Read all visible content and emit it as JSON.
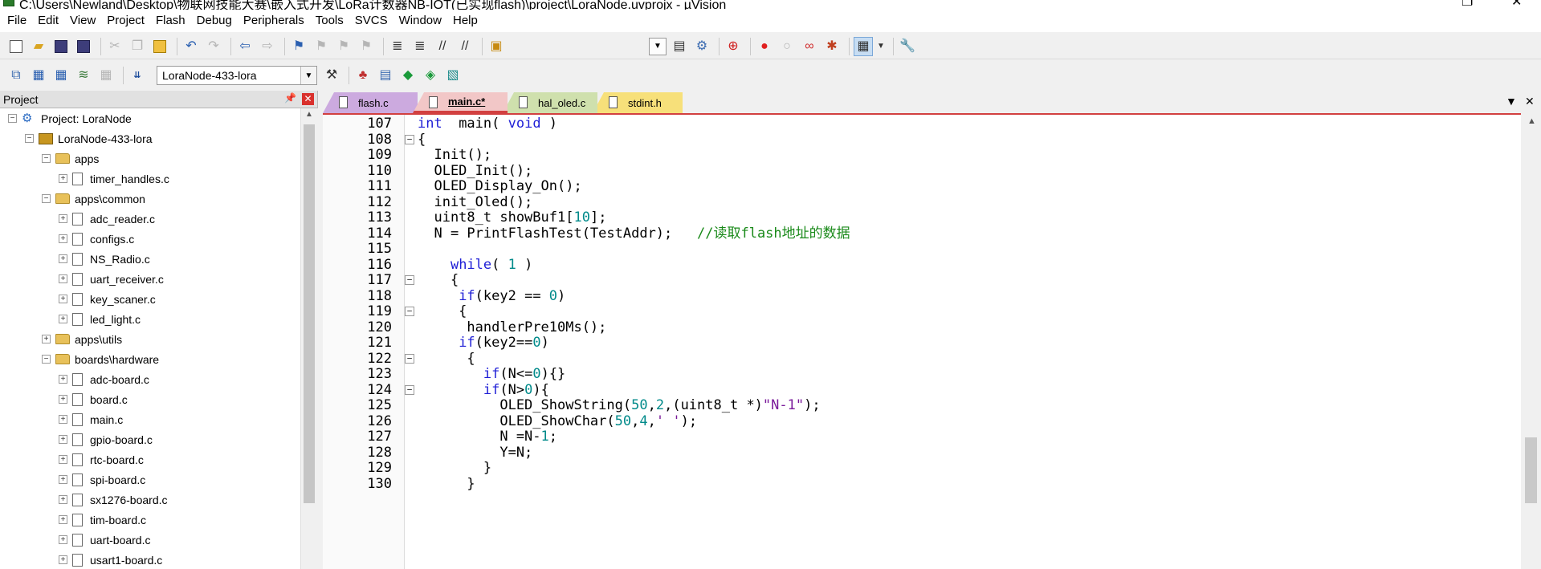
{
  "window": {
    "title": "C:\\Users\\Newland\\Desktop\\物联网技能大赛\\嵌入式开发\\LoRa计数器NB-IOT(已实现flash)\\project\\LoraNode.uvprojx - µVision"
  },
  "menu": [
    "File",
    "Edit",
    "View",
    "Project",
    "Flash",
    "Debug",
    "Peripherals",
    "Tools",
    "SVCS",
    "Window",
    "Help"
  ],
  "toolbar": {
    "target_name": "LoraNode-433-lora"
  },
  "project_panel": {
    "title": "Project",
    "tree": [
      {
        "label": "Project: LoraNode",
        "type": "project",
        "level": 0,
        "expander": "⊟"
      },
      {
        "label": "LoraNode-433-lora",
        "type": "target",
        "level": 1,
        "expander": "⊟"
      },
      {
        "label": "apps",
        "type": "folder",
        "level": 2,
        "expander": "⊟"
      },
      {
        "label": "timer_handles.c",
        "type": "file",
        "level": 3,
        "expander": "⊞"
      },
      {
        "label": "apps\\common",
        "type": "folder",
        "level": 2,
        "expander": "⊟"
      },
      {
        "label": "adc_reader.c",
        "type": "file",
        "level": 3,
        "expander": "⊞"
      },
      {
        "label": "configs.c",
        "type": "file",
        "level": 3,
        "expander": "⊞"
      },
      {
        "label": "NS_Radio.c",
        "type": "file",
        "level": 3,
        "expander": "⊞"
      },
      {
        "label": "uart_receiver.c",
        "type": "file",
        "level": 3,
        "expander": "⊞"
      },
      {
        "label": "key_scaner.c",
        "type": "file",
        "level": 3,
        "expander": "⊞"
      },
      {
        "label": "led_light.c",
        "type": "file",
        "level": 3,
        "expander": "⊞"
      },
      {
        "label": "apps\\utils",
        "type": "folder",
        "level": 2,
        "expander": "⊞"
      },
      {
        "label": "boards\\hardware",
        "type": "folder",
        "level": 2,
        "expander": "⊟"
      },
      {
        "label": "adc-board.c",
        "type": "file",
        "level": 3,
        "expander": "⊞"
      },
      {
        "label": "board.c",
        "type": "file",
        "level": 3,
        "expander": "⊞"
      },
      {
        "label": "main.c",
        "type": "file",
        "level": 3,
        "expander": "⊞"
      },
      {
        "label": "gpio-board.c",
        "type": "file",
        "level": 3,
        "expander": "⊞"
      },
      {
        "label": "rtc-board.c",
        "type": "file",
        "level": 3,
        "expander": "⊞"
      },
      {
        "label": "spi-board.c",
        "type": "file",
        "level": 3,
        "expander": "⊞"
      },
      {
        "label": "sx1276-board.c",
        "type": "file",
        "level": 3,
        "expander": "⊞"
      },
      {
        "label": "tim-board.c",
        "type": "file",
        "level": 3,
        "expander": "⊞"
      },
      {
        "label": "uart-board.c",
        "type": "file",
        "level": 3,
        "expander": "⊞"
      },
      {
        "label": "usart1-board.c",
        "type": "file",
        "level": 3,
        "expander": "⊞"
      }
    ]
  },
  "tabs": [
    {
      "label": "flash.c",
      "active": false
    },
    {
      "label": "main.c*",
      "active": true
    },
    {
      "label": "hal_oled.c",
      "active": false
    },
    {
      "label": "stdint.h",
      "active": false
    }
  ],
  "editor": {
    "lines": [
      {
        "num": "107",
        "fold": "",
        "tokens": [
          [
            "k",
            "int"
          ],
          [
            "",
            "  main( "
          ],
          [
            "k",
            "void"
          ],
          [
            "",
            " )"
          ]
        ]
      },
      {
        "num": "108",
        "fold": "⊟",
        "tokens": [
          [
            "",
            "{"
          ]
        ]
      },
      {
        "num": "109",
        "fold": "",
        "tokens": [
          [
            "",
            "  Init();"
          ]
        ]
      },
      {
        "num": "110",
        "fold": "",
        "tokens": [
          [
            "",
            "  OLED_Init();"
          ]
        ]
      },
      {
        "num": "111",
        "fold": "",
        "tokens": [
          [
            "",
            "  OLED_Display_On();"
          ]
        ]
      },
      {
        "num": "112",
        "fold": "",
        "tokens": [
          [
            "",
            "  init_Oled();"
          ]
        ]
      },
      {
        "num": "113",
        "fold": "",
        "tokens": [
          [
            "",
            "  uint8_t showBuf1["
          ],
          [
            "n",
            "10"
          ],
          [
            "",
            "];"
          ]
        ]
      },
      {
        "num": "114",
        "fold": "",
        "tokens": [
          [
            "",
            "  N = PrintFlashTest(TestAddr);   "
          ],
          [
            "c",
            "//读取flash地址的数据"
          ]
        ]
      },
      {
        "num": "115",
        "fold": "",
        "tokens": [
          [
            "",
            ""
          ]
        ]
      },
      {
        "num": "116",
        "fold": "",
        "tokens": [
          [
            "",
            "    "
          ],
          [
            "k",
            "while"
          ],
          [
            "",
            "( "
          ],
          [
            "n",
            "1"
          ],
          [
            "",
            " )"
          ]
        ]
      },
      {
        "num": "117",
        "fold": "⊟",
        "tokens": [
          [
            "",
            "    {"
          ]
        ]
      },
      {
        "num": "118",
        "fold": "",
        "tokens": [
          [
            "",
            "     "
          ],
          [
            "k",
            "if"
          ],
          [
            "",
            "(key2 == "
          ],
          [
            "n",
            "0"
          ],
          [
            "",
            ")"
          ]
        ]
      },
      {
        "num": "119",
        "fold": "⊟",
        "tokens": [
          [
            "",
            "     {"
          ]
        ]
      },
      {
        "num": "120",
        "fold": "",
        "tokens": [
          [
            "",
            "      handlerPre10Ms();"
          ]
        ]
      },
      {
        "num": "121",
        "fold": "",
        "tokens": [
          [
            "",
            "     "
          ],
          [
            "k",
            "if"
          ],
          [
            "",
            "(key2=="
          ],
          [
            "n",
            "0"
          ],
          [
            "",
            ")"
          ]
        ]
      },
      {
        "num": "122",
        "fold": "⊟",
        "tokens": [
          [
            "",
            "      {"
          ]
        ]
      },
      {
        "num": "123",
        "fold": "",
        "tokens": [
          [
            "",
            "        "
          ],
          [
            "k",
            "if"
          ],
          [
            "",
            "(N<="
          ],
          [
            "n",
            "0"
          ],
          [
            "",
            "){}"
          ]
        ]
      },
      {
        "num": "124",
        "fold": "⊟",
        "tokens": [
          [
            "",
            "        "
          ],
          [
            "k",
            "if"
          ],
          [
            "",
            "(N>"
          ],
          [
            "n",
            "0"
          ],
          [
            "",
            "){"
          ]
        ]
      },
      {
        "num": "125",
        "fold": "",
        "tokens": [
          [
            "",
            "          OLED_ShowString("
          ],
          [
            "n",
            "50"
          ],
          [
            "",
            ","
          ],
          [
            "n",
            "2"
          ],
          [
            "",
            ",(uint8_t *)"
          ],
          [
            "s",
            "\"N-1\""
          ],
          [
            "",
            ");"
          ]
        ]
      },
      {
        "num": "126",
        "fold": "",
        "tokens": [
          [
            "",
            "          OLED_ShowChar("
          ],
          [
            "n",
            "50"
          ],
          [
            "",
            ","
          ],
          [
            "n",
            "4"
          ],
          [
            "",
            ","
          ],
          [
            "s",
            "' '"
          ],
          [
            "",
            ");"
          ]
        ]
      },
      {
        "num": "127",
        "fold": "",
        "tokens": [
          [
            "",
            "          N =N-"
          ],
          [
            "n",
            "1"
          ],
          [
            "",
            ";"
          ]
        ]
      },
      {
        "num": "128",
        "fold": "",
        "tokens": [
          [
            "",
            "          Y=N;"
          ]
        ]
      },
      {
        "num": "129",
        "fold": "",
        "tokens": [
          [
            "",
            "        }"
          ]
        ]
      },
      {
        "num": "130",
        "fold": "",
        "tokens": [
          [
            "",
            "      }"
          ]
        ]
      }
    ]
  }
}
